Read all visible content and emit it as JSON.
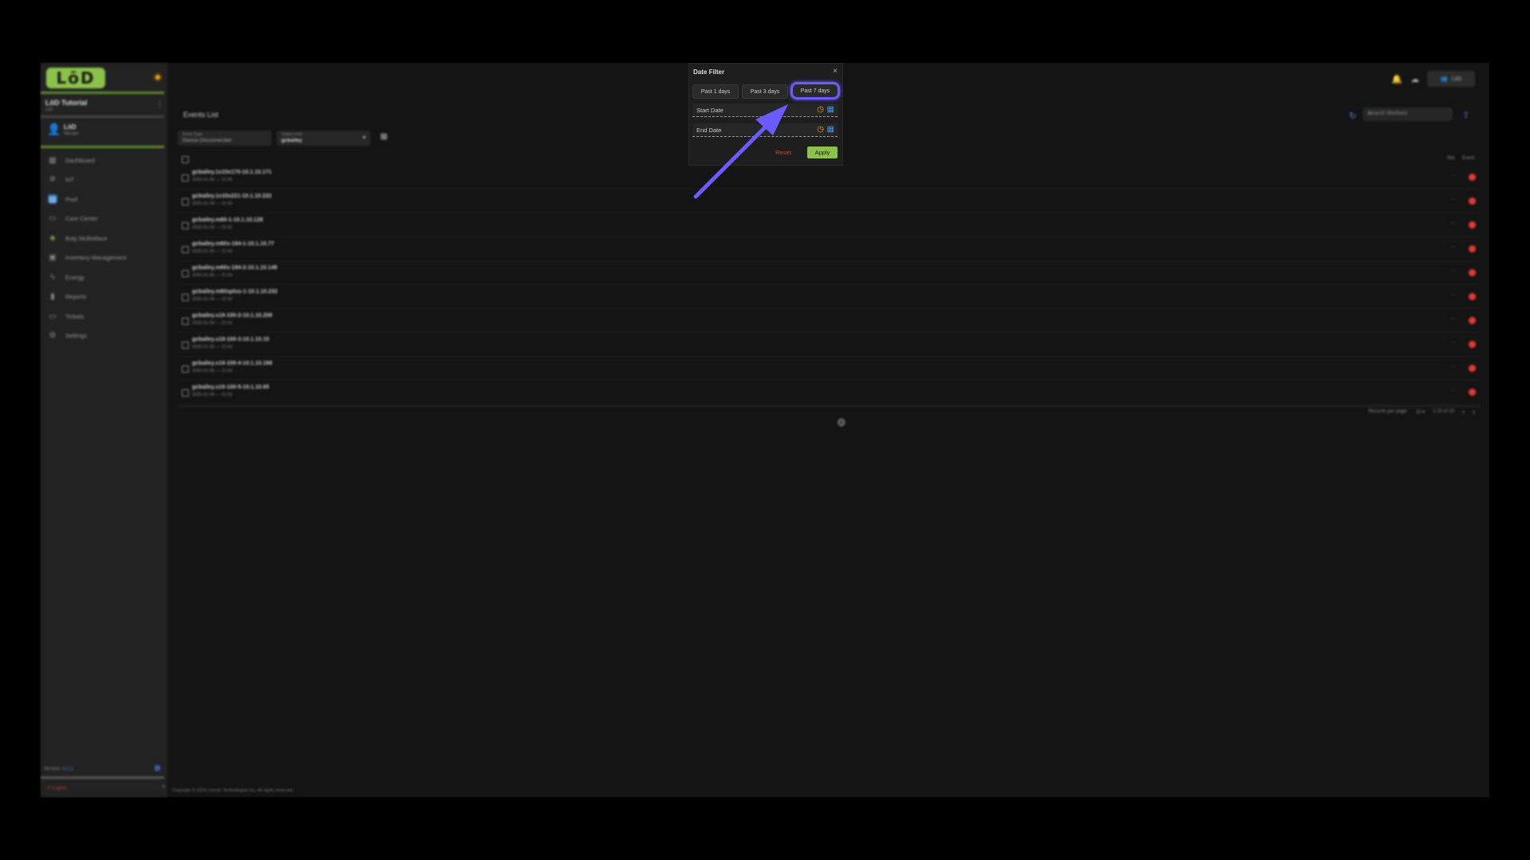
{
  "sidebar": {
    "logo": "LōD",
    "org_title": "LōD Tutorial",
    "org_sub": "LōD",
    "user_name": "LōD",
    "user_role": "Manager",
    "nav": [
      {
        "label": "Dashboard",
        "icon": "dashboard-icon"
      },
      {
        "label": "IoT",
        "icon": "iot-icon"
      },
      {
        "label": "Pool",
        "icon": "pool-icon"
      },
      {
        "label": "Care Center",
        "icon": "care-center-icon"
      },
      {
        "label": "Boty McBotface",
        "icon": "bot-icon"
      },
      {
        "label": "Inventory Management",
        "icon": "inventory-icon"
      },
      {
        "label": "Energy",
        "icon": "energy-icon"
      },
      {
        "label": "Reports",
        "icon": "reports-icon"
      },
      {
        "label": "Tickets",
        "icon": "tickets-icon"
      },
      {
        "label": "Settings",
        "icon": "settings-icon"
      }
    ],
    "version_label": "Version:",
    "version": "3.2.1",
    "logout": "Logout"
  },
  "header": {
    "user_button": "LōD",
    "search_placeholder": "Search Workers"
  },
  "main": {
    "title": "Events List",
    "filters": {
      "event_type_label": "Event Type",
      "event_type_value": "Device Disconnected",
      "subaccount_label": "Subaccount",
      "subaccount_value": "gcbailey"
    },
    "columns": {
      "rel": "Rel",
      "event": "Event"
    },
    "rows": [
      {
        "name": "gcbailey.1x10x170-10.1.10.171",
        "time": "2025-01-06 — 21:53"
      },
      {
        "name": "gcbailey.1x10x221-10.1.10.222",
        "time": "2025-01-06 — 21:53"
      },
      {
        "name": "gcbailey.m60-1-10.1.10.128",
        "time": "2025-01-06 — 21:53"
      },
      {
        "name": "gcbailey.m60s-184-1-10.1.10.77",
        "time": "2025-01-06 — 21:53"
      },
      {
        "name": "gcbailey.m60s-184-2-10.1.10.148",
        "time": "2025-01-06 — 21:53"
      },
      {
        "name": "gcbailey.m60splus-1-10.1.10.232",
        "time": "2025-01-06 — 21:53"
      },
      {
        "name": "gcbailey.s19-100-2-10.1.10.208",
        "time": "2025-01-06 — 21:53"
      },
      {
        "name": "gcbailey.s19-100-3-10.1.10.15",
        "time": "2025-01-06 — 21:53"
      },
      {
        "name": "gcbailey.s19-100-4-10.1.10.168",
        "time": "2025-01-06 — 21:53"
      },
      {
        "name": "gcbailey.s19-100-5-10.1.10.65",
        "time": "2025-01-06 — 21:53"
      }
    ],
    "row_dots": "···",
    "pager": {
      "records_label": "Records per page:",
      "records_value": "10",
      "range": "1-10 of 15"
    },
    "footer": "Copyright © 2024 Lincoln Technologies Inc. All rights reserved."
  },
  "date_filter": {
    "title": "Date Filter",
    "close": "×",
    "quick": [
      "Past 1 days",
      "Past 3 days",
      "Past 7 days"
    ],
    "start_label": "Start Date",
    "end_label": "End Date",
    "reset": "Reset",
    "apply": "Apply"
  },
  "colors": {
    "accent_green": "#8bc34a",
    "highlight": "#6a5cff",
    "error_red": "#e53935",
    "blue": "#4a8fe0"
  }
}
